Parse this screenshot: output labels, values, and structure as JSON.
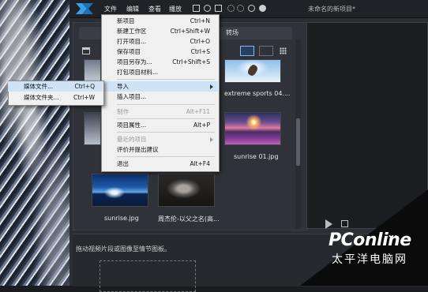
{
  "window": {
    "title": "未命名的新项目*"
  },
  "menubar": {
    "items": [
      {
        "label": "文件"
      },
      {
        "label": "编辑"
      },
      {
        "label": "查看"
      },
      {
        "label": "播放"
      }
    ]
  },
  "library": {
    "tab_transition": "转场",
    "media": [
      {
        "caption": "extreme sports 04...."
      },
      {
        "caption": "sunrise 01.jpg"
      },
      {
        "caption": "sunrise.jpg"
      },
      {
        "caption": "周杰伦-以父之名(高..."
      }
    ]
  },
  "file_menu": {
    "items": [
      {
        "label": "新项目",
        "shortcut": "Ctrl+N"
      },
      {
        "label": "新建工作区",
        "shortcut": "Ctrl+Shift+W"
      },
      {
        "label": "打开项目...",
        "shortcut": "Ctrl+O"
      },
      {
        "label": "保存项目",
        "shortcut": "Ctrl+S"
      },
      {
        "label": "项目另存为...",
        "shortcut": "Ctrl+Shift+S"
      },
      {
        "label": "打包项目材料..."
      },
      {
        "label": "导入"
      },
      {
        "label": "插入项目..."
      },
      {
        "label": "制作",
        "shortcut": "Alt+F11"
      },
      {
        "label": "项目属性...",
        "shortcut": "Alt+P"
      },
      {
        "label": "最近的项目"
      },
      {
        "label": "评价并提出建议"
      },
      {
        "label": "退出",
        "shortcut": "Alt+F4"
      }
    ]
  },
  "import_submenu": {
    "items": [
      {
        "label": "媒体文件...",
        "shortcut": "Ctrl+Q"
      },
      {
        "label": "媒体文件夹...",
        "shortcut": "Ctrl+W"
      }
    ]
  },
  "storyboard": {
    "hint": "拖动视频片段或图像至情节图板。"
  },
  "watermark": {
    "logo": "PConline",
    "trail": "...",
    "sub": "太平洋电脑网"
  },
  "colors": {
    "menu_bg": "#f0f0f0",
    "highlight": "#cfe3f7",
    "app_bg": "#2b2e33"
  }
}
